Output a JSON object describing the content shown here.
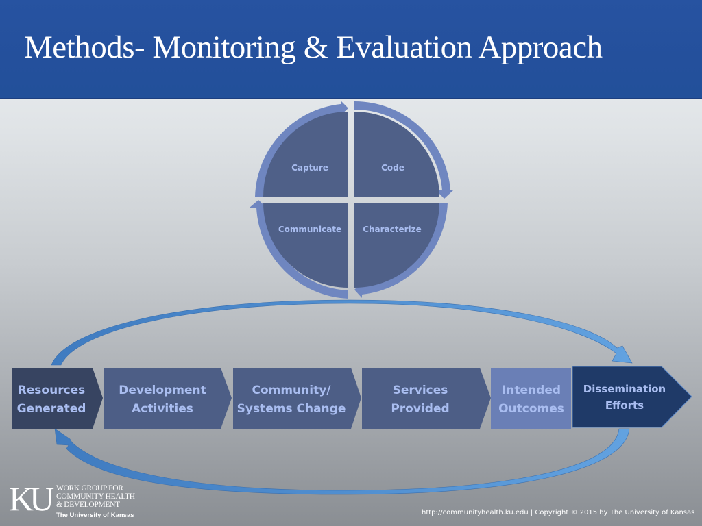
{
  "slide": {
    "title": "Methods- Monitoring & Evaluation Approach"
  },
  "cycle": {
    "quadrants": [
      {
        "label": "Capture",
        "position": "top-left"
      },
      {
        "label": "Code",
        "position": "top-right"
      },
      {
        "label": "Characterize",
        "position": "bottom-right"
      },
      {
        "label": "Communicate",
        "position": "bottom-left"
      }
    ],
    "colors": {
      "fill": "#4f6088",
      "ring": "#6f86c0",
      "text": "#a9bdf0"
    }
  },
  "process": {
    "steps": [
      {
        "line1": "Resources",
        "line2": "Generated",
        "color": "#374461"
      },
      {
        "line1": "Development",
        "line2": "Activities",
        "color": "#4d5e86"
      },
      {
        "line1": "Community/",
        "line2": "Systems Change",
        "color": "#4d5e86"
      },
      {
        "line1": "Services",
        "line2": "Provided",
        "color": "#4d5e86"
      },
      {
        "line1": "Intended",
        "line2": "Outcomes",
        "color": "#6a7fb6"
      },
      {
        "line1": "Dissemination",
        "line2": "Efforts",
        "color": "#1f3a68"
      }
    ],
    "arrow_color": "#5b9bd8"
  },
  "logo": {
    "mark": "KU",
    "line1": "WORK GROUP FOR",
    "line2": "COMMUNITY HEALTH",
    "line3": "& DEVELOPMENT",
    "university": "The University of Kansas"
  },
  "footer": {
    "text": "http://communityhealth.ku.edu | Copyright © 2015 by The University of Kansas"
  }
}
